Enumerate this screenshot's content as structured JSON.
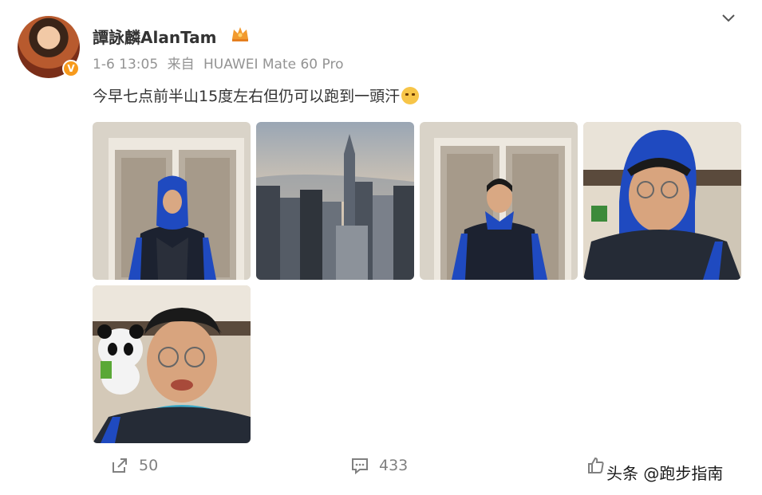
{
  "post": {
    "username": "譚詠麟AlanTam",
    "timestamp": "1-6 13:05",
    "source_prefix": "来自",
    "source_device": "HUAWEI Mate 60 Pro",
    "text": "今早七点前半山15度左右但仍可以跑到一頭汗",
    "verified_badge": "V"
  },
  "icons": {
    "crown": "crown-icon",
    "menu": "chevron-down-icon",
    "share": "share-icon",
    "comment": "comment-icon",
    "like": "thumbs-up-icon",
    "emoji": "sweat-face-emoji"
  },
  "actions": {
    "share_count": "50",
    "comment_count": "433"
  },
  "watermark": {
    "text": "头条 @跑步指南"
  },
  "colors": {
    "meta_gray": "#939393",
    "badge_orange": "#f79a1c",
    "action_gray": "#808080"
  }
}
